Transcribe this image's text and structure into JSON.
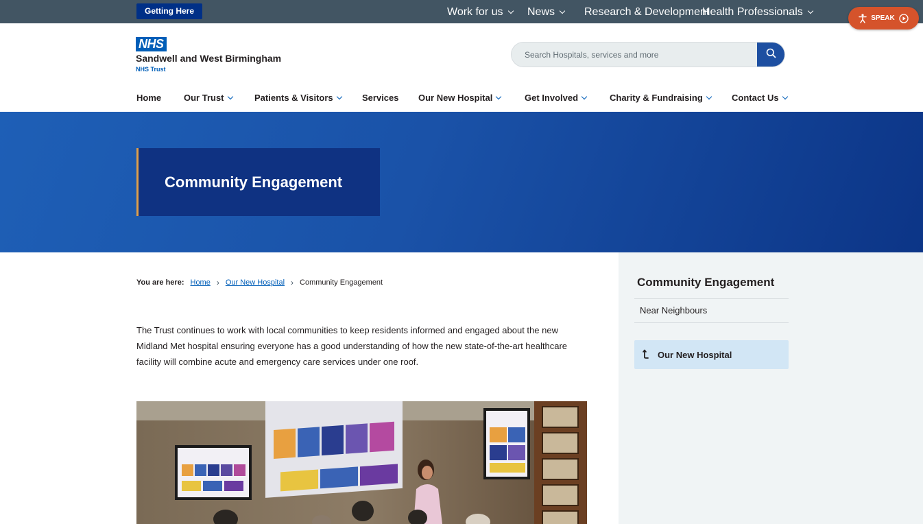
{
  "utility_bar": {
    "getting_here": "Getting Here",
    "links": [
      {
        "label": "Work for us",
        "has_dropdown": true
      },
      {
        "label": "News",
        "has_dropdown": true
      },
      {
        "label": "Research & Development",
        "has_dropdown": false
      },
      {
        "label": "Health Professionals",
        "has_dropdown": true
      }
    ],
    "speak_label": "SPEAK"
  },
  "header": {
    "logo_text": "NHS",
    "org_name": "Sandwell and West Birmingham",
    "org_sub": "NHS Trust",
    "search_placeholder": "Search Hospitals, services and more"
  },
  "main_nav": [
    {
      "label": "Home",
      "has_dropdown": false
    },
    {
      "label": "Our Trust",
      "has_dropdown": true
    },
    {
      "label": "Patients & Visitors",
      "has_dropdown": true
    },
    {
      "label": "Services",
      "has_dropdown": false
    },
    {
      "label": "Our New Hospital",
      "has_dropdown": true
    },
    {
      "label": "Get Involved",
      "has_dropdown": true
    },
    {
      "label": "Charity & Fundraising",
      "has_dropdown": true
    },
    {
      "label": "Contact Us",
      "has_dropdown": true
    }
  ],
  "hero": {
    "title": "Community Engagement"
  },
  "breadcrumb": {
    "label": "You are here:",
    "items": [
      "Home",
      "Our New Hospital"
    ],
    "current": "Community Engagement"
  },
  "content": {
    "intro": "The Trust continues to work with local communities to keep residents informed and engaged about the new Midland Met hospital ensuring everyone has a good understanding of how the new state-of-the-art healthcare facility will combine acute and emergency care services under one roof."
  },
  "sidebar": {
    "title": "Community Engagement",
    "links": [
      "Near Neighbours"
    ],
    "parent_link": "Our New Hospital"
  },
  "colors": {
    "nhs_blue": "#005eb8",
    "utility_bar": "#425563",
    "hero_dark": "#0f3282",
    "accent_orange": "#e0a04a",
    "speak_orange": "#d5532b",
    "sidebar_bg": "#f0f4f5",
    "parent_link_bg": "#d2e6f5"
  }
}
